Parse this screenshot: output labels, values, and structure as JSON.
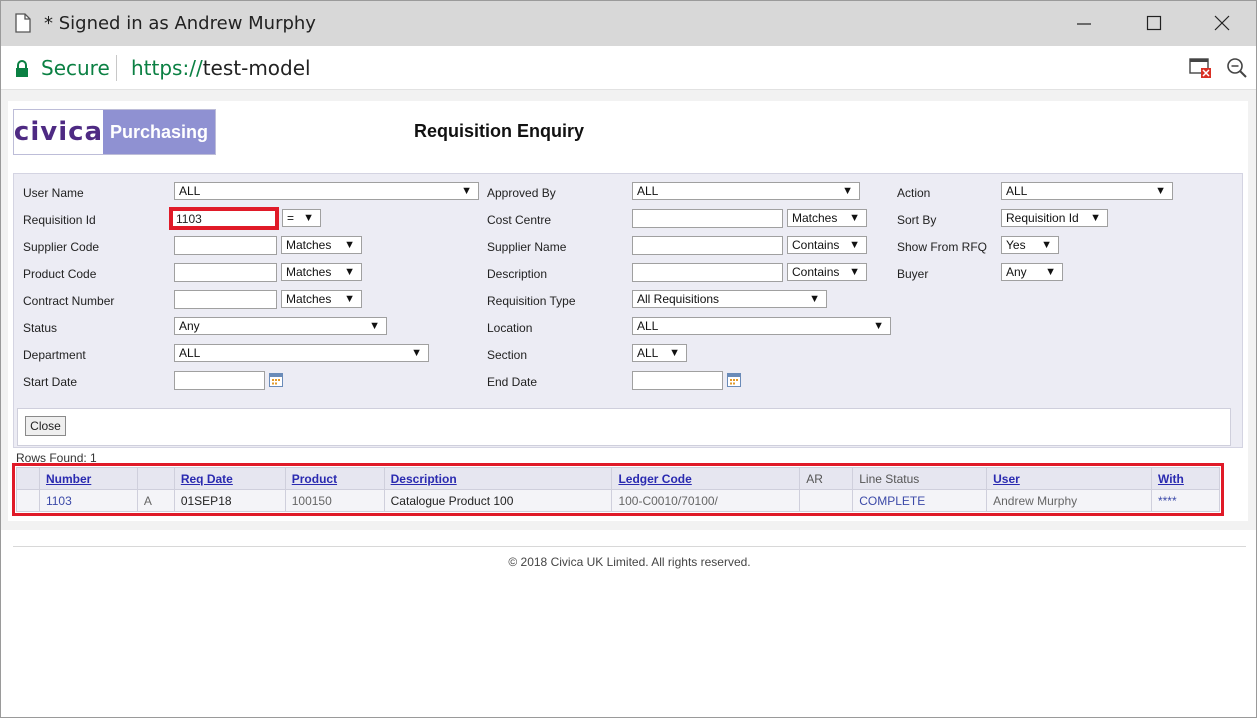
{
  "window": {
    "title": "* Signed in as Andrew Murphy"
  },
  "address": {
    "secure_label": "Secure",
    "scheme": "https://",
    "host": "test-model"
  },
  "logo": {
    "brand": "civica",
    "product": "Purchasing"
  },
  "page": {
    "title": "Requisition Enquiry"
  },
  "filters": {
    "user_name": {
      "label": "User Name",
      "value": "ALL"
    },
    "requisition_id": {
      "label": "Requisition Id",
      "value": "1103",
      "op": "="
    },
    "supplier_code": {
      "label": "Supplier Code",
      "value": "",
      "op": "Matches"
    },
    "product_code": {
      "label": "Product Code",
      "value": "",
      "op": "Matches"
    },
    "contract_number": {
      "label": "Contract Number",
      "value": "",
      "op": "Matches"
    },
    "status": {
      "label": "Status",
      "value": "Any"
    },
    "department": {
      "label": "Department",
      "value": "ALL"
    },
    "start_date": {
      "label": "Start Date",
      "value": ""
    },
    "approved_by": {
      "label": "Approved By",
      "value": "ALL"
    },
    "cost_centre": {
      "label": "Cost Centre",
      "value": "",
      "op": "Matches"
    },
    "supplier_name": {
      "label": "Supplier Name",
      "value": "",
      "op": "Contains"
    },
    "description": {
      "label": "Description",
      "value": "",
      "op": "Contains"
    },
    "requisition_type": {
      "label": "Requisition Type",
      "value": "All Requisitions"
    },
    "location": {
      "label": "Location",
      "value": "ALL"
    },
    "section": {
      "label": "Section",
      "value": "ALL"
    },
    "end_date": {
      "label": "End Date",
      "value": ""
    },
    "action": {
      "label": "Action",
      "value": "ALL"
    },
    "sort_by": {
      "label": "Sort By",
      "value": "Requisition Id"
    },
    "show_from_rfq": {
      "label": "Show From RFQ",
      "value": "Yes"
    },
    "buyer": {
      "label": "Buyer",
      "value": "Any"
    }
  },
  "close_label": "Close",
  "rows_found": {
    "label": "Rows Found:",
    "count": "1"
  },
  "results": {
    "headers": [
      "",
      "Number",
      "",
      "Req Date",
      "Product",
      "Description",
      "Ledger Code",
      "AR",
      "Line Status",
      "User",
      "With"
    ],
    "rows": [
      [
        "",
        "1103",
        "A",
        "01SEP18",
        "100150",
        "Catalogue Product 100",
        "100-C0010/70100/",
        "",
        "COMPLETE",
        "Andrew Murphy",
        "****"
      ]
    ]
  },
  "footer": "© 2018 Civica UK Limited. All rights reserved.",
  "colors": {
    "accent": "#8f91d2",
    "highlight": "#e01a28",
    "secure": "#0b8043"
  }
}
